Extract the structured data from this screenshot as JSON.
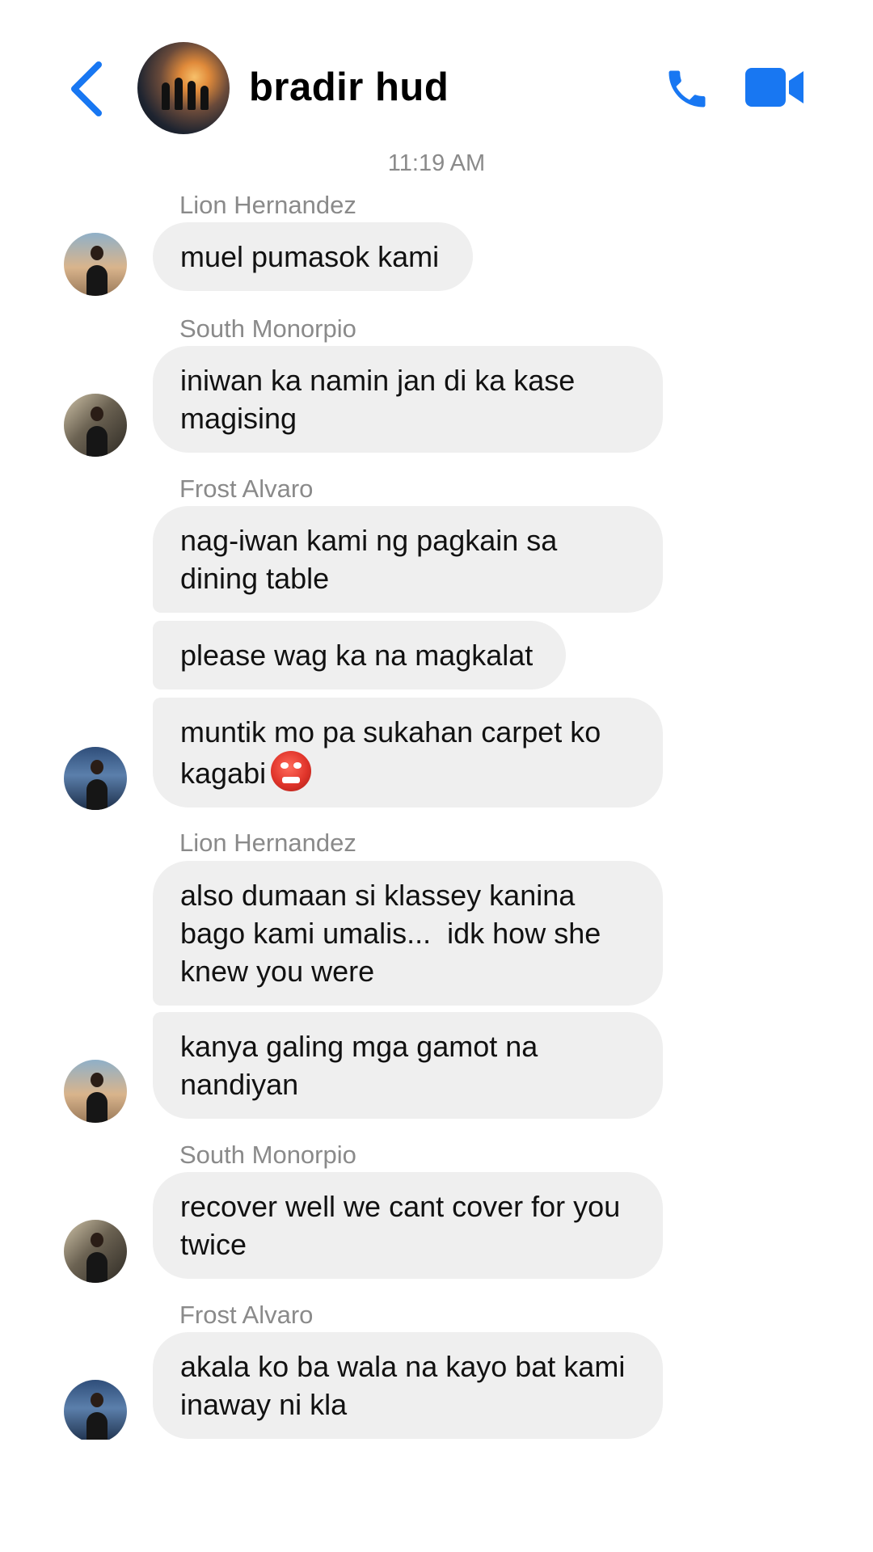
{
  "header": {
    "title": "bradir hud",
    "back_icon": "chevron-left-icon",
    "call_icon": "phone-icon",
    "video_icon": "video-camera-icon",
    "accent": "#1877F2"
  },
  "timestamp": "11:19 AM",
  "messages": [
    {
      "sender": "Lion Hernandez",
      "text": "muel pumasok kami"
    },
    {
      "sender": "South Monorpio",
      "text": "iniwan ka namin jan di ka kase\nmagising"
    },
    {
      "sender": "Frost Alvaro",
      "text": "nag-iwan kami ng pagkain sa\ndining table"
    },
    {
      "sender": "Frost Alvaro",
      "text": "please wag ka na magkalat"
    },
    {
      "sender": "Frost Alvaro",
      "text": "muntik mo pa sukahan carpet ko\nkagabi",
      "emoji": "angry-devil-emoji"
    },
    {
      "sender": "Lion Hernandez",
      "text": "also dumaan si klassey kanina\nbago kami umalis...  idk how she\nknew you were"
    },
    {
      "sender": "Lion Hernandez",
      "text": "kanya galing mga gamot na\nnandiyan"
    },
    {
      "sender": "South Monorpio",
      "text": "recover well we cant cover for you\ntwice"
    },
    {
      "sender": "Frost Alvaro",
      "text": "akala ko ba wala na kayo bat kami\ninaway ni kla"
    }
  ],
  "bubble_color": "#EFEFEF",
  "meta_color": "#8A8A8A"
}
